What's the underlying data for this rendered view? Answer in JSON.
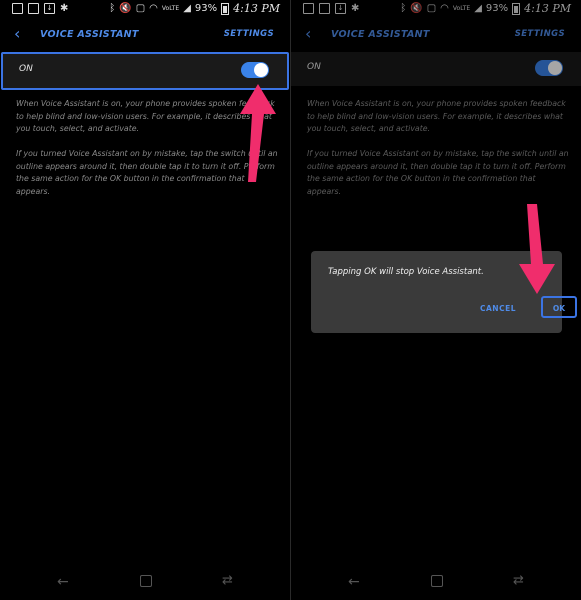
{
  "status": {
    "signal_text": "VoLTE",
    "battery_pct": "93%",
    "time": "4:13 PM"
  },
  "appbar": {
    "title": "VOICE ASSISTANT",
    "settings_label": "SETTINGS"
  },
  "toggle": {
    "label": "ON",
    "state": "on"
  },
  "description": {
    "para1": "When Voice Assistant is on, your phone provides spoken feedback to help blind and low-vision users. For example, it describes what you touch, select, and activate.",
    "para2": "If you turned Voice Assistant on by mistake, tap the switch until an outline appears around it, then double tap it to turn it off. Perform the same action for the OK button in the confirmation that appears."
  },
  "dialog": {
    "message": "Tapping OK will stop Voice Assistant.",
    "cancel_label": "CANCEL",
    "ok_label": "OK"
  },
  "colors": {
    "accent": "#4f8be8",
    "arrow": "#f02d6c",
    "background": "#000000"
  }
}
